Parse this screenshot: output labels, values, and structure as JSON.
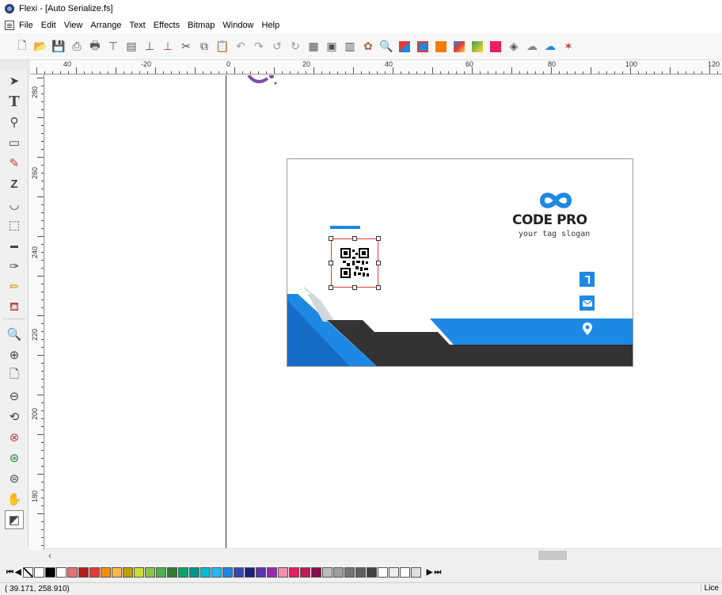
{
  "window": {
    "title": "Flexi - [Auto Serialize.fs]"
  },
  "menu": {
    "items": [
      "File",
      "Edit",
      "View",
      "Arrange",
      "Text",
      "Effects",
      "Bitmap",
      "Window",
      "Help"
    ]
  },
  "toolbar": {
    "icons": [
      "new-document-icon",
      "open-icon",
      "save-icon",
      "print-setup-icon",
      "print-icon",
      "plot-icon",
      "cut-file-icon",
      "rip-icon",
      "output-icon",
      "production-manager-icon",
      "cut-icon",
      "copy-icon",
      "paste-icon",
      "undo-icon",
      "redo-icon",
      "undo-all-icon",
      "redo-all-icon",
      "design-central-icon",
      "preferences-icon",
      "job-info-icon",
      "color-icon",
      "zoom-icon",
      "color-palette-icon",
      "pantone-icon",
      "effects-icon",
      "gradient-icon",
      "bitmap-icon",
      "serialize-icon",
      "contour-icon",
      "cloud-icon",
      "cloud-upload-icon",
      "share-icon"
    ]
  },
  "rulers": {
    "horizontal_labels": [
      "40",
      "-20",
      "0",
      "20",
      "40",
      "60",
      "80",
      "100",
      "120"
    ],
    "vertical_labels": [
      "280",
      "260",
      "240",
      "220",
      "200",
      "180"
    ]
  },
  "tools": [
    "select-arrow-icon",
    "text-tool-icon",
    "shape-edit-icon",
    "rectangle-tool-icon",
    "spline-tool-icon",
    "distort-tool-icon",
    "arc-tool-icon",
    "frame-tool-icon",
    "measure-tool-icon",
    "eyedropper-icon",
    "pencil-tool-icon",
    "fill-bucket-icon",
    "zoom-fit-icon",
    "zoom-in-icon",
    "zoom-page-icon",
    "zoom-out-icon",
    "zoom-previous-icon",
    "zoom-cancel-icon",
    "zoom-all-icon",
    "zoom-selected-icon",
    "pan-hand-icon",
    "fill-stroke-icon"
  ],
  "card": {
    "brand_name": "CODE PRO",
    "slogan": "your tag slogan",
    "contact_icons": [
      "phone-icon",
      "email-icon",
      "location-icon"
    ],
    "colors": {
      "blue": "#1e88e5",
      "dark": "#333333",
      "accent_purple": "#7b4fa8"
    }
  },
  "palette": {
    "colors": [
      "#ffffff",
      "#000000",
      "#ffffff",
      "#e57373",
      "#b71c1c",
      "#e53935",
      "#fb8c00",
      "#ffb74d",
      "#c0a000",
      "#cddc39",
      "#8bc34a",
      "#4caf50",
      "#2e7d32",
      "#00a86b",
      "#009688",
      "#00bcd4",
      "#29b6f6",
      "#1e88e5",
      "#3949ab",
      "#1a237e",
      "#5e35b1",
      "#9c27b0",
      "#f48fb1",
      "#e91e63",
      "#c2185b",
      "#880e4f",
      "#bdbdbd",
      "#9e9e9e",
      "#757575",
      "#616161",
      "#424242",
      "#ffffff",
      "#eeeeee",
      "#ffffff",
      "#e0e0e0"
    ]
  },
  "status": {
    "coordinates": "( 39.171,  258.910)",
    "right_text": "Lice"
  }
}
